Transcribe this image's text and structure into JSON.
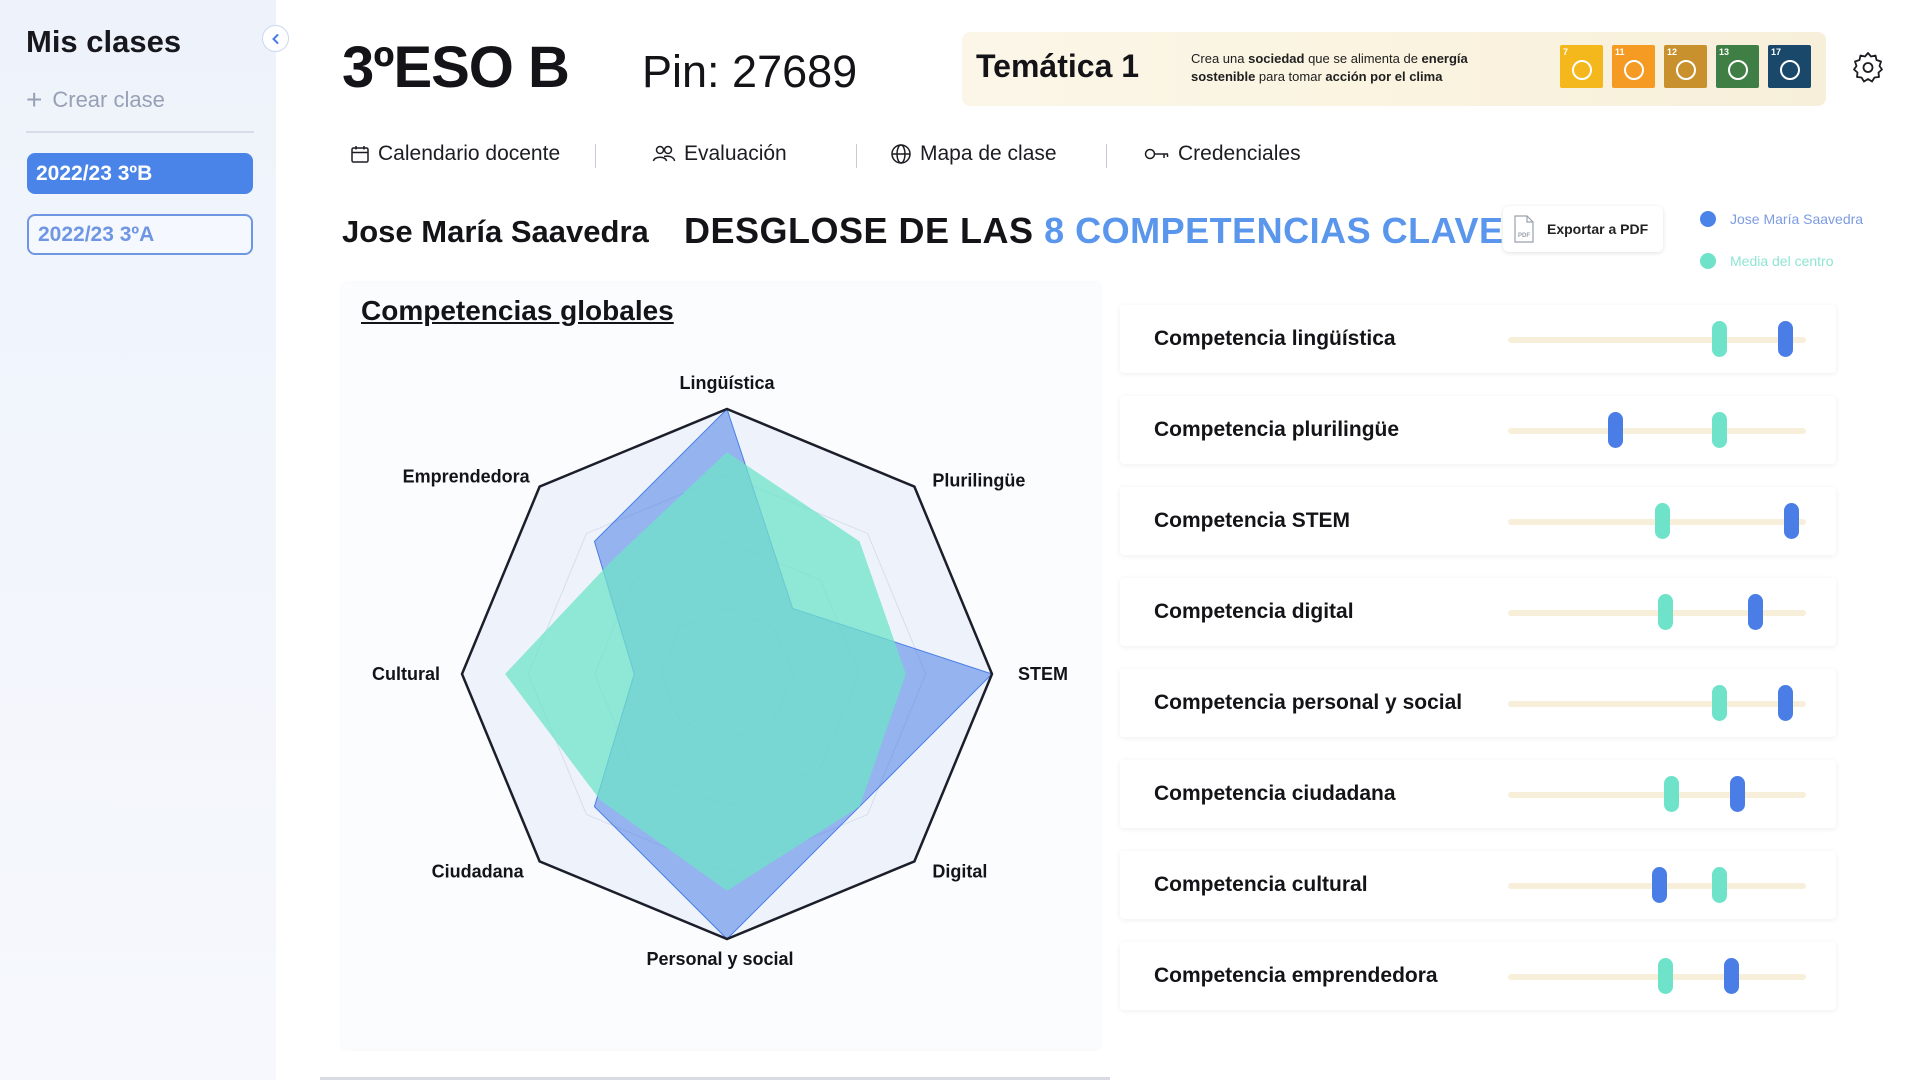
{
  "sidebar": {
    "title": "Mis clases",
    "create_label": "Crear clase",
    "classes": [
      {
        "label": "2022/23 3ºB",
        "active": true
      },
      {
        "label": "2022/23 3ºA",
        "active": false
      }
    ]
  },
  "header": {
    "class_name": "3ºESO B",
    "pin": "Pin: 27689",
    "theme": {
      "label": "Temática 1",
      "description_parts": [
        "Crea una ",
        "sociedad",
        " que se alimenta de ",
        "energía",
        " ",
        "sostenible",
        " para tomar ",
        "acción por el clima"
      ],
      "sdg_icons": [
        {
          "number": "7",
          "color": "#f5b81c"
        },
        {
          "number": "11",
          "color": "#f59b24"
        },
        {
          "number": "12",
          "color": "#c9912e"
        },
        {
          "number": "13",
          "color": "#3f7e44"
        },
        {
          "number": "17",
          "color": "#19486a"
        }
      ]
    }
  },
  "tabs": [
    {
      "label": "Calendario docente",
      "icon": "calendar-icon"
    },
    {
      "label": "Evaluación",
      "icon": "users-icon"
    },
    {
      "label": "Mapa de clase",
      "icon": "globe-icon"
    },
    {
      "label": "Credenciales",
      "icon": "key-icon"
    }
  ],
  "section": {
    "student_name": "Jose María Saavedra",
    "heading_prefix": "DESGLOSE DE LAS",
    "heading_accent": "8 COMPETENCIAS CLAVE",
    "export_label": "Exportar a PDF"
  },
  "legend": [
    {
      "label": "Jose María Saavedra",
      "color": "#4a84e8"
    },
    {
      "label": "Media del centro",
      "color": "#6fe3c9"
    }
  ],
  "colors": {
    "student": "#4a7ee6",
    "school": "#6fe3c9",
    "accent": "#5a96ec",
    "track": "#f7efd9"
  },
  "chart_data": {
    "type": "radar",
    "title": "Competencias globales",
    "axes": [
      "Lingüística",
      "Plurilingüe",
      "STEM",
      "Digital",
      "Personal y social",
      "Ciudadana",
      "Cultural",
      "Emprendedora"
    ],
    "range": [
      0,
      1
    ],
    "series": [
      {
        "name": "Jose María Saavedra",
        "values": [
          1.0,
          0.0,
          1.0,
          0.55,
          1.0,
          0.55,
          0.0,
          0.55
        ]
      },
      {
        "name": "Media del centro",
        "values": [
          0.75,
          0.55,
          0.5,
          0.55,
          0.72,
          0.5,
          0.75,
          0.4
        ]
      }
    ]
  },
  "competencies": [
    {
      "label": "Competencia lingüística",
      "school": 0.71,
      "student": 0.93
    },
    {
      "label": "Competencia plurilingüe",
      "school": 0.71,
      "student": 0.36
    },
    {
      "label": "Competencia STEM",
      "school": 0.52,
      "student": 0.95
    },
    {
      "label": "Competencia digital",
      "school": 0.53,
      "student": 0.83
    },
    {
      "label": "Competencia personal y social",
      "school": 0.71,
      "student": 0.93
    },
    {
      "label": "Competencia ciudadana",
      "school": 0.55,
      "student": 0.77
    },
    {
      "label": "Competencia cultural",
      "school": 0.71,
      "student": 0.51
    },
    {
      "label": "Competencia emprendedora",
      "school": 0.53,
      "student": 0.75
    }
  ]
}
